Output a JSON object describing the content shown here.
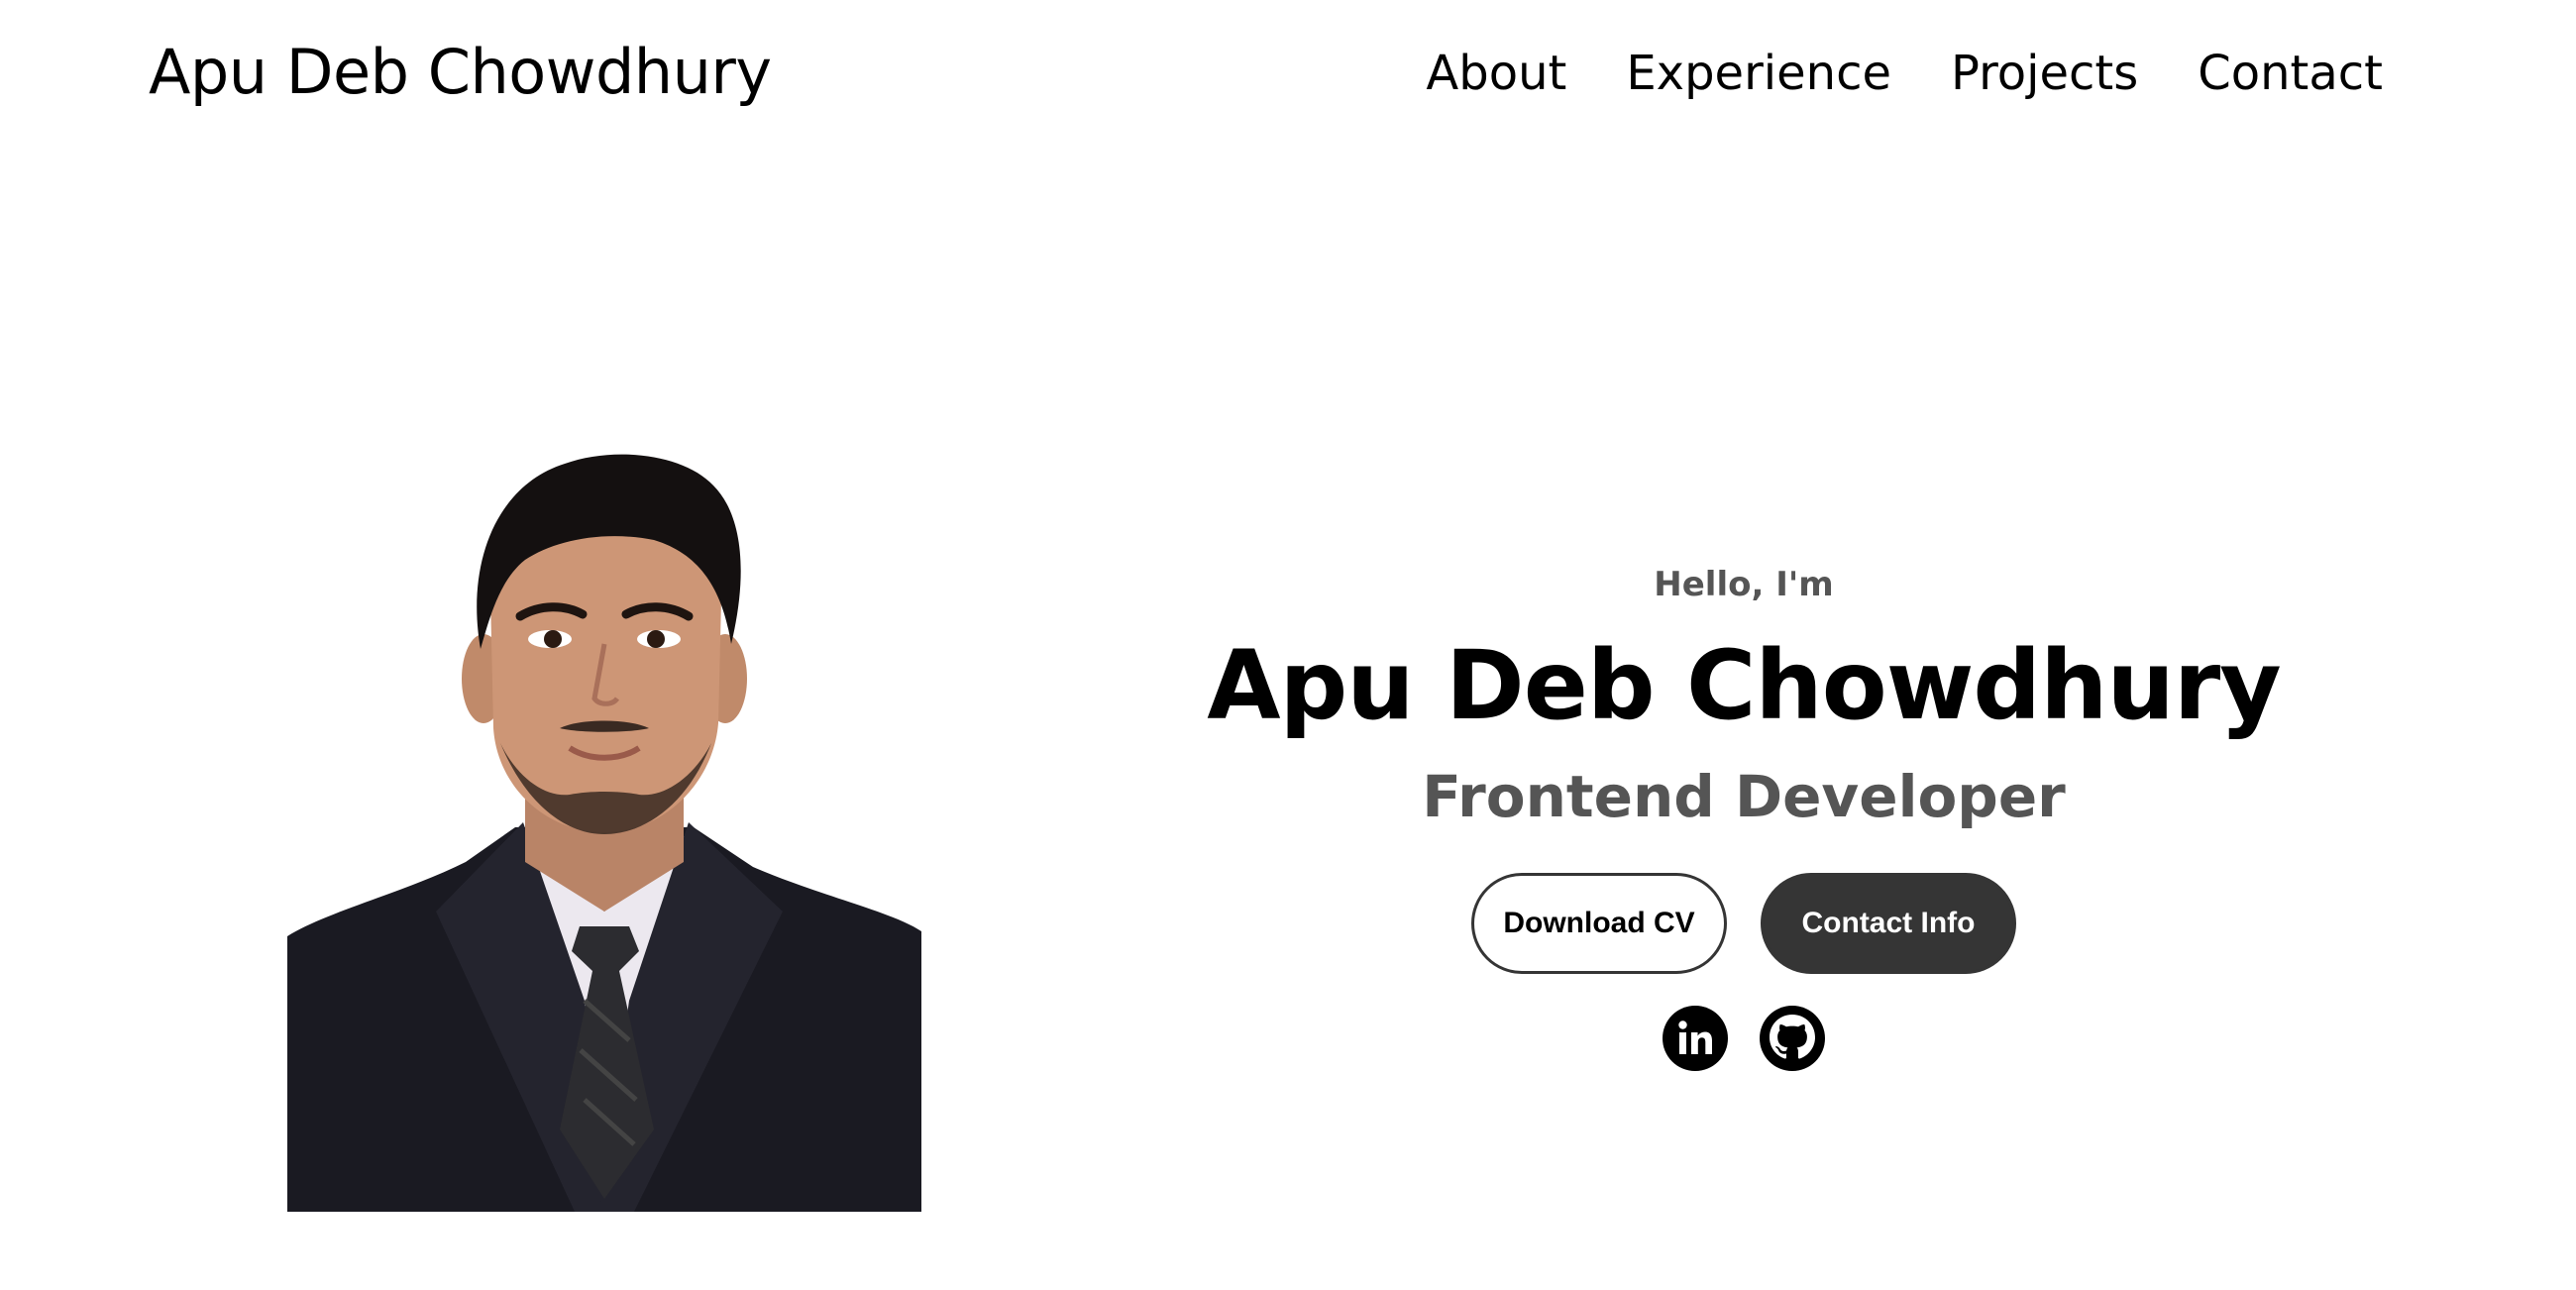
{
  "header": {
    "logo": "Apu Deb Chowdhury",
    "nav": [
      {
        "label": "About"
      },
      {
        "label": "Experience"
      },
      {
        "label": "Projects"
      },
      {
        "label": "Contact"
      }
    ]
  },
  "hero": {
    "greeting": "Hello, I'm",
    "name": "Apu Deb Chowdhury",
    "role": "Frontend Developer",
    "buttons": {
      "download_cv": "Download CV",
      "contact_info": "Contact Info"
    },
    "social": [
      {
        "icon": "linkedin-icon"
      },
      {
        "icon": "github-icon"
      }
    ]
  },
  "colors": {
    "text": "#000000",
    "muted": "#555555",
    "button_dark": "#353535",
    "background": "#ffffff"
  }
}
